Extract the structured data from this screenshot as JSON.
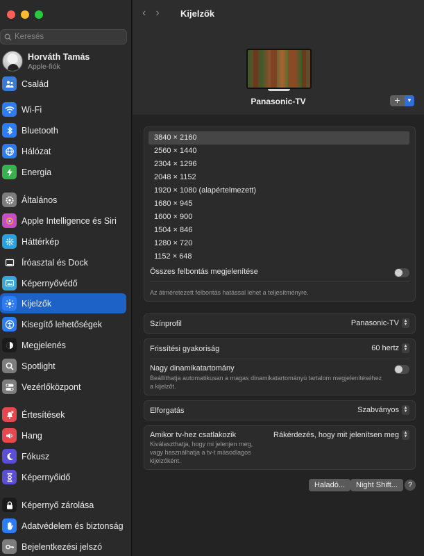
{
  "window": {
    "title": "Kijelzők"
  },
  "search": {
    "placeholder": "Keresés"
  },
  "user": {
    "name": "Horváth Tamás",
    "subtitle": "Apple-fiók"
  },
  "sidebar": {
    "items": [
      {
        "label": "Család",
        "icon": "family-icon",
        "color": "#3a7bd5"
      },
      {
        "label": "Wi-Fi",
        "icon": "wifi-icon",
        "color": "#2d7cf6"
      },
      {
        "label": "Bluetooth",
        "icon": "bluetooth-icon",
        "color": "#2d7cf6"
      },
      {
        "label": "Hálózat",
        "icon": "globe-icon",
        "color": "#2d7cf6"
      },
      {
        "label": "Energia",
        "icon": "battery-icon",
        "color": "#37b24d"
      },
      {
        "label": "Általános",
        "icon": "gear-icon",
        "color": "#7d7d7d"
      },
      {
        "label": "Apple Intelligence és Siri",
        "icon": "siri-icon",
        "color": "#c84cc4"
      },
      {
        "label": "Háttérkép",
        "icon": "flower-icon",
        "color": "#29a3e0"
      },
      {
        "label": "Íróasztal és Dock",
        "icon": "dock-icon",
        "color": "#2b2b2b"
      },
      {
        "label": "Képernyővédő",
        "icon": "screensaver-icon",
        "color": "#3aa6d8"
      },
      {
        "label": "Kijelzők",
        "icon": "sun-icon",
        "color": "#2d7cf6"
      },
      {
        "label": "Kisegítő lehetőségek",
        "icon": "accessibility-icon",
        "color": "#2d7cf6"
      },
      {
        "label": "Megjelenés",
        "icon": "appearance-icon",
        "color": "#1b1b1b"
      },
      {
        "label": "Spotlight",
        "icon": "magnifier-icon",
        "color": "#7d7d7d"
      },
      {
        "label": "Vezérlőközpont",
        "icon": "toggles-icon",
        "color": "#7d7d7d"
      },
      {
        "label": "Értesítések",
        "icon": "bell-icon",
        "color": "#e5484d"
      },
      {
        "label": "Hang",
        "icon": "speaker-icon",
        "color": "#e5484d"
      },
      {
        "label": "Fókusz",
        "icon": "moon-icon",
        "color": "#5b4fd6"
      },
      {
        "label": "Képernyőidő",
        "icon": "hourglass-icon",
        "color": "#5b4fd6"
      },
      {
        "label": "Képernyő zárolása",
        "icon": "lock-icon",
        "color": "#1b1b1b"
      },
      {
        "label": "Adatvédelem és biztonság",
        "icon": "hand-icon",
        "color": "#2d7cf6"
      },
      {
        "label": "Bejelentkezési jelszó",
        "icon": "key-icon",
        "color": "#7d7d7d"
      }
    ]
  },
  "display": {
    "name": "Panasonic-TV",
    "add_symbol": "+"
  },
  "resolutions": {
    "items": [
      "3840 × 2160",
      "2560 × 1440",
      "2304 × 1296",
      "2048 × 1152",
      "1920 × 1080 (alapértelmezett)",
      "1680 × 945",
      "1600 × 900",
      "1504 × 846",
      "1280 × 720",
      "1152 × 648"
    ],
    "selected": "3840 × 2160",
    "show_all_label": "Összes felbontás megjelenítése",
    "note": "Az átméretezett felbontás hatással lehet a teljesítményre."
  },
  "color_profile": {
    "label": "Színprofil",
    "value": "Panasonic-TV"
  },
  "refresh": {
    "label": "Frissítési gyakoriság",
    "value": "60 hertz",
    "hdr_label": "Nagy dinamikatartomány",
    "hdr_desc_1": "Beállíthatja automatikusan a magas dinamikatartományú tartalom megjelenítéséhez",
    "hdr_desc_2": "a kijelzőt."
  },
  "rotation": {
    "label": "Elforgatás",
    "value": "Szabványos"
  },
  "tv_connect": {
    "label": "Amikor tv-hez csatlakozik",
    "desc_1": "Kiválaszthatja, hogy mi jelenjen meg,",
    "desc_2": "vagy használhatja a tv-t másodlagos",
    "desc_3": "kijelzőként.",
    "value": "Rákérdezés, hogy mit jelenítsen meg"
  },
  "buttons": {
    "advanced": "Haladó...",
    "night_shift": "Night Shift...",
    "help": "?"
  }
}
